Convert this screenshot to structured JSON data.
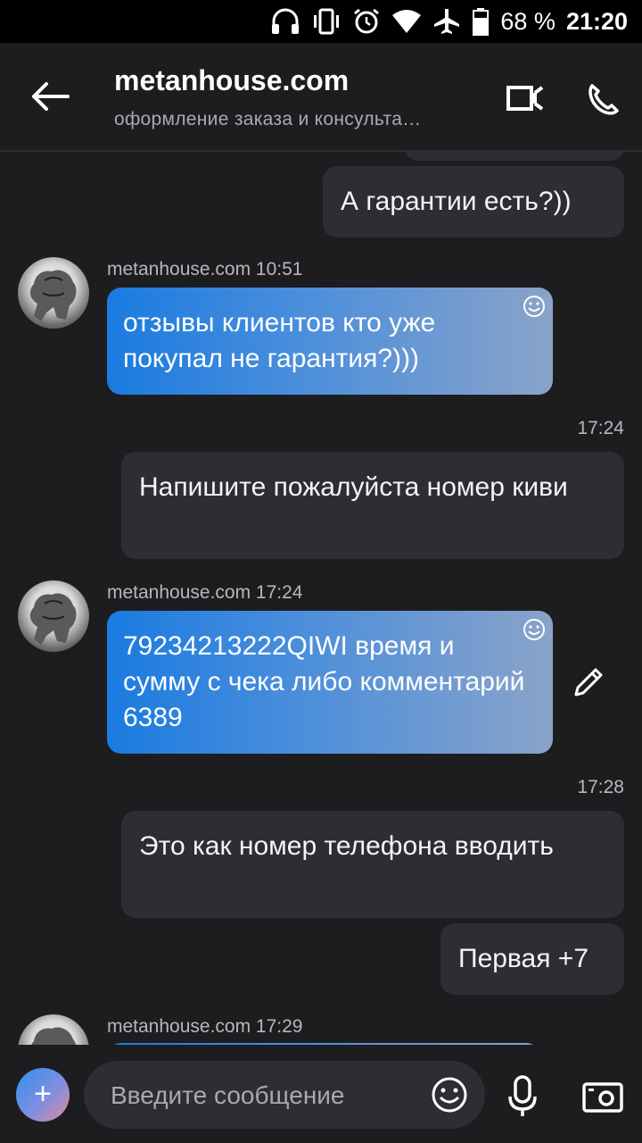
{
  "status_bar": {
    "battery_percent": "68 %",
    "clock": "21:20"
  },
  "header": {
    "title": "metanhouse.com",
    "subtitle": "оформление заказа и консульта…"
  },
  "messages": [
    {
      "out_1": "А гарантии есть?))"
    },
    {
      "meta_1": "metanhouse.com 10:51",
      "in_1": "отзывы клиентов кто уже покупал не гарантия?)))"
    },
    {
      "time_1": "17:24",
      "out_2": "Напишите пожалуйста номер киви"
    },
    {
      "meta_2": "metanhouse.com 17:24",
      "in_2": "79234213222QIWI время и сумму с чека либо комментарий 6389"
    },
    {
      "time_2": "17:28",
      "out_3": "Это как номер телефона вводить",
      "out_4": "Первая +7"
    },
    {
      "meta_3": "metanhouse.com 17:29"
    }
  ],
  "composer": {
    "placeholder": "Введите сообщение",
    "plus_label": "+"
  },
  "colors": {
    "background": "#1d1d20",
    "outgoing_bubble": "#2d2d33",
    "incoming_gradient_start": "#1a7be0",
    "incoming_gradient_end": "#8aa3c9"
  }
}
